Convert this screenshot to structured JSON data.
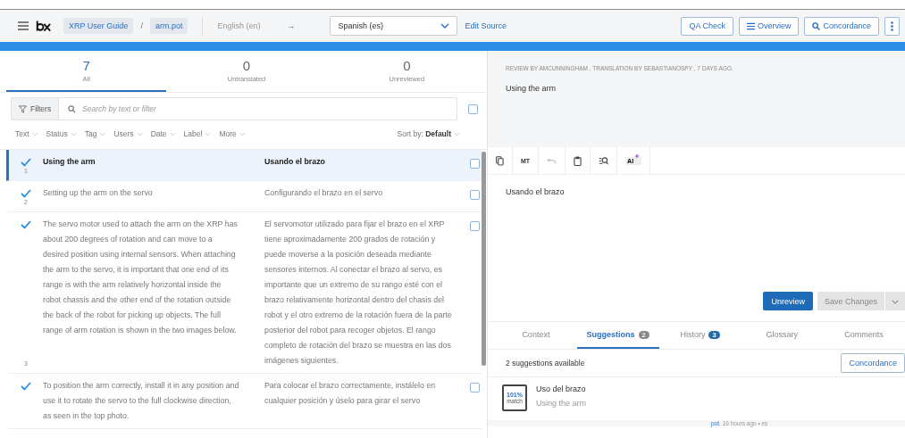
{
  "header": {
    "breadcrumbs": [
      "XRP User Guide",
      "arm.pot"
    ],
    "separator": "/",
    "source_language": "English (en)",
    "arrow": "→",
    "target_language": "Spanish (es)",
    "edit_source": "Edit Source",
    "buttons": [
      {
        "label": "QA Check",
        "kind": "plain"
      },
      {
        "label": "Overview",
        "kind": "list"
      },
      {
        "label": "Concordance",
        "kind": "search"
      }
    ]
  },
  "status_tabs": [
    {
      "count": "7",
      "label": "All",
      "selected": true
    },
    {
      "count": "0",
      "label": "Untranslated",
      "selected": false
    },
    {
      "count": "0",
      "label": "Unreviewed",
      "selected": false
    }
  ],
  "search": {
    "filters_label": "Filters",
    "placeholder": "Search by text or filter",
    "select_all_checked": false
  },
  "filters": [
    "Text",
    "Status",
    "Tag",
    "Users",
    "Date",
    "Label",
    "More"
  ],
  "sort": {
    "label": "Sort by:",
    "value": "Default"
  },
  "strings": [
    {
      "number": "1",
      "source": "Using the arm",
      "translation": "Usando el brazo",
      "reviewed": true,
      "selected": true,
      "checked": false
    },
    {
      "number": "2",
      "source": "Setting up the arm on the servo",
      "translation": "Configurando el brazo en el servo",
      "reviewed": true,
      "selected": false,
      "checked": false
    },
    {
      "number": "3",
      "source": "The servo motor used to attach the arm on the XRP has about 200 degrees of rotation and can move to a desired position using internal sensors. When attaching the arm to the servo, it is important that one end of its range is with the arm relatively horizontal inside the robot chassis and the other end of the rotation outside the back of the robot for picking up objects. The full range of arm rotation is shown in the two images below.",
      "translation": "El servomotor utilizado para fijar el brazo en el XRP tiene aproximadamente 200 grados de rotación y puede moverse a la posición deseada mediante sensores internos. Al conectar el brazo al servo, es importante que un extremo de su rango esté con el brazo relativamente horizontal dentro del chasis del robot y el otro extremo de la rotación fuera de la parte posterior del robot para recoger objetos. El rango completo de rotación del brazo se muestra en las dos imágenes siguientes.",
      "reviewed": true,
      "selected": false,
      "checked": false
    },
    {
      "source": "To position the arm correctly, install it in any position and use it to rotate the servo to the full clockwise direction, as seen in the top photo.",
      "translation": "Para colocar el brazo correctamente, instálelo en cualquier posición y úselo para girar el servo",
      "reviewed": true,
      "selected": false,
      "checked": false
    }
  ],
  "detail": {
    "meta": "REVIEW BY AMCUNNINGHAM , TRANSLATION BY SEBASTIANOSPY , 7 DAYS AGO.",
    "source": "Using the arm",
    "toolbar": [
      {
        "kind": "copy"
      },
      {
        "kind": "text",
        "label": "MT"
      },
      {
        "kind": "undo"
      },
      {
        "kind": "clipboard"
      },
      {
        "kind": "search"
      },
      {
        "kind": "ai",
        "label": "AI"
      }
    ],
    "translation": "Usando el brazo",
    "primary_button": "Unreview",
    "save_button": {
      "label": "Save Changes",
      "disabled": true
    }
  },
  "panel_tabs": [
    {
      "label": "Context",
      "selected": false
    },
    {
      "label": "Suggestions",
      "badge": "2",
      "color": "#8a8a8a",
      "selected": true
    },
    {
      "label": "History",
      "badge": "3",
      "color": "#1e6bb8",
      "selected": false
    },
    {
      "label": "Glossary",
      "selected": false
    },
    {
      "label": "Comments",
      "selected": false
    }
  ],
  "suggestions": {
    "summary": "2 suggestions available",
    "concordance": "Concordance",
    "items": [
      {
        "match": "101%",
        "match_label": "match",
        "text": "Uso del brazo",
        "source": "Using the arm"
      }
    ],
    "meta_link": "pot",
    "meta": ", 16 hours ago • es"
  }
}
